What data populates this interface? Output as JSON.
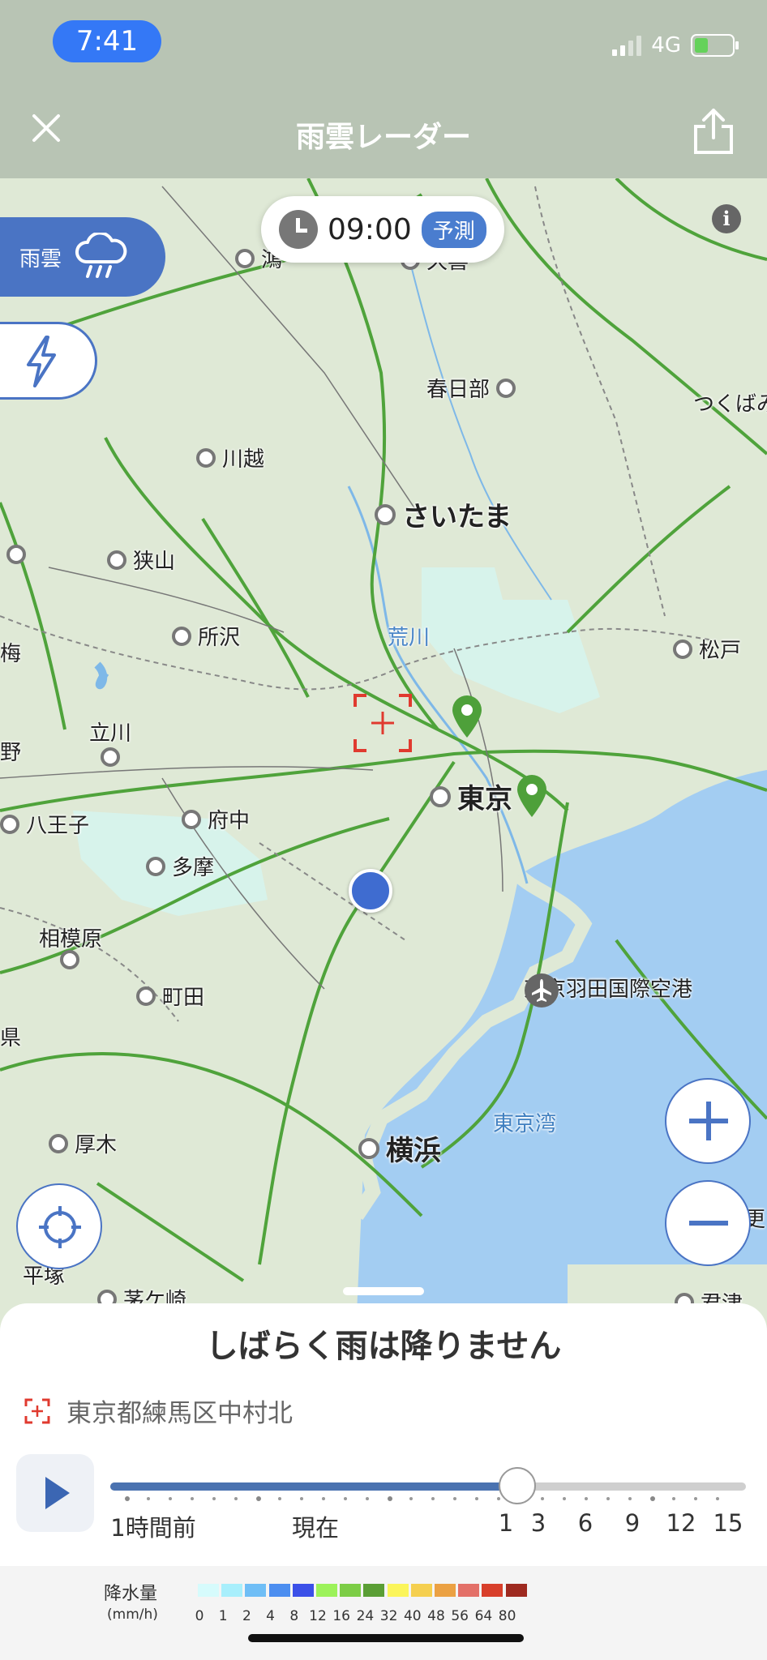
{
  "status_bar": {
    "time": "7:41",
    "network": "4G"
  },
  "header": {
    "title": "雨雲レーダー",
    "close_icon": "close-icon",
    "share_icon": "share-icon"
  },
  "map": {
    "time": "09:00",
    "forecast_label": "予測",
    "rain_tab_label": "雨雲",
    "bay_label": "東京湾",
    "river_label": "荒川",
    "places": {
      "kasukabe": "春日部",
      "kawagoe": "川越",
      "saitama": "さいたま",
      "sayama": "狭山",
      "tokorozawa": "所沢",
      "matsudo": "松戸",
      "tachikawa": "立川",
      "tokyo": "東京",
      "fuchu": "府中",
      "hachioji": "八王子",
      "tama": "多摩",
      "sagamihara": "相模原",
      "machida": "町田",
      "haneda": "東京羽田国際空港",
      "atsugi": "厚木",
      "yokohama": "横浜",
      "hiratsuka": "平塚",
      "chigasaki": "茅ケ崎",
      "tsukuba": "つくばみ",
      "ome": "梅",
      "hino": "野",
      "kumagaya": "鴻",
      "kuki": "久喜",
      "ken": "県",
      "kisarazu": "君津",
      "sara": "更"
    }
  },
  "sheet": {
    "status_message": "しばらく雨は降りません",
    "location": "東京都練馬区中村北",
    "slider_position": 0.64,
    "tick_labels": [
      "1時間前",
      "現在",
      "1",
      "3",
      "6",
      "9",
      "12",
      "15"
    ]
  },
  "legend": {
    "title": "降水量",
    "unit": "(mm/h)",
    "values": [
      "0",
      "1",
      "2",
      "4",
      "8",
      "12",
      "16",
      "24",
      "32",
      "40",
      "48",
      "56",
      "64",
      "80"
    ],
    "colors": [
      "#d6fbfc",
      "#a8effc",
      "#6fbef6",
      "#4c8ef0",
      "#3b50e8",
      "#9cf25a",
      "#7ccd46",
      "#5a9e35",
      "#fbf55a",
      "#f5cf4f",
      "#eba143",
      "#e37068",
      "#d83f2b",
      "#9e2a20"
    ]
  }
}
